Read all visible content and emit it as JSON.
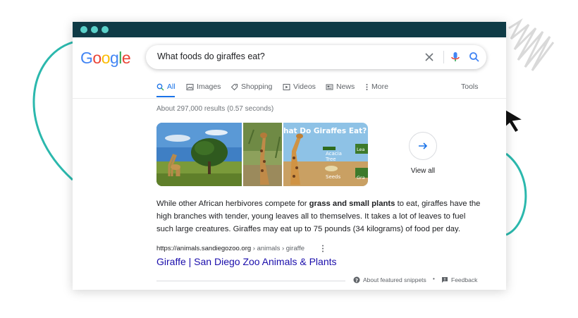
{
  "search": {
    "query": "What foods do giraffes eat?"
  },
  "logo": {
    "letters": [
      {
        "char": "G",
        "color": "#4285F4"
      },
      {
        "char": "o",
        "color": "#EA4335"
      },
      {
        "char": "o",
        "color": "#FBBC05"
      },
      {
        "char": "g",
        "color": "#4285F4"
      },
      {
        "char": "l",
        "color": "#34A853"
      },
      {
        "char": "e",
        "color": "#EA4335"
      }
    ]
  },
  "tabs": {
    "all": "All",
    "images": "Images",
    "shopping": "Shopping",
    "videos": "Videos",
    "news": "News",
    "more": "More",
    "tools": "Tools"
  },
  "results": {
    "stats": "About 297,000 results (0.57 seconds)"
  },
  "images": {
    "infographic_title": "hat Do Giraffes Eat?",
    "label_acacia": "Acacia",
    "label_tree": "Tree",
    "label_seeds": "Seeds",
    "label_lea": "Lea",
    "label_gra": "Gra",
    "view_all": "View all"
  },
  "snippet": {
    "part1": "While other African herbivores compete for ",
    "bold": "grass and small plants",
    "part2": " to eat, giraffes have the high branches with tender, young leaves all to themselves. It takes a lot of leaves to fuel such large creatures. Giraffes may eat up to 75 pounds (34 kilograms) of food per day.",
    "url": "https://animals.sandiegozoo.org",
    "breadcrumbs": " › animals › giraffe",
    "title": "Giraffe | San Diego Zoo Animals & Plants"
  },
  "footer": {
    "about": "About featured snippets",
    "separator": "•",
    "feedback": "Feedback"
  },
  "colors": {
    "titlebar": "#0f3b46",
    "dots": "#5ad1c9",
    "link": "#1a0dab",
    "accent": "#1a73e8",
    "decoration": "#2bb8ad"
  },
  "icons": [
    "search-icon",
    "image-icon",
    "tag-icon",
    "play-icon",
    "news-icon",
    "more-icon",
    "clear-icon",
    "mic-icon",
    "arrow-right-icon",
    "help-icon",
    "feedback-icon",
    "cursor-icon"
  ]
}
